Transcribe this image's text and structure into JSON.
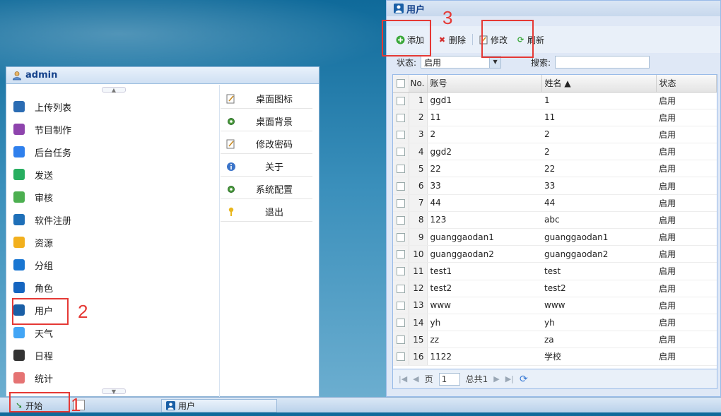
{
  "start_menu": {
    "username": "admin",
    "left_items": [
      {
        "label": "上传列表",
        "icon": "upload-icon",
        "color": "#2b6cb3"
      },
      {
        "label": "节目制作",
        "icon": "program-icon",
        "color": "#8e44ad"
      },
      {
        "label": "后台任务",
        "icon": "tasks-icon",
        "color": "#2f80ed"
      },
      {
        "label": "发送",
        "icon": "send-icon",
        "color": "#27ae60"
      },
      {
        "label": "审核",
        "icon": "check-icon",
        "color": "#4caf50"
      },
      {
        "label": "软件注册",
        "icon": "register-icon",
        "color": "#1e6fb8"
      },
      {
        "label": "资源",
        "icon": "resource-icon",
        "color": "#f2b01e"
      },
      {
        "label": "分组",
        "icon": "group-icon",
        "color": "#1976d2"
      },
      {
        "label": "角色",
        "icon": "role-icon",
        "color": "#1565c0"
      },
      {
        "label": "用户",
        "icon": "user-icon",
        "color": "#1a5fa6"
      },
      {
        "label": "天气",
        "icon": "weather-icon",
        "color": "#42a5f5"
      },
      {
        "label": "日程",
        "icon": "schedule-icon",
        "color": "#333333"
      },
      {
        "label": "统计",
        "icon": "stats-icon",
        "color": "#e57373"
      }
    ],
    "right_items": [
      {
        "label": "桌面图标",
        "icon": "edit-icon"
      },
      {
        "label": "桌面背景",
        "icon": "gear-icon"
      },
      {
        "label": "修改密码",
        "icon": "edit-icon"
      },
      {
        "label": "关于",
        "icon": "info-icon"
      },
      {
        "label": "系统配置",
        "icon": "gear-icon"
      },
      {
        "label": "退出",
        "icon": "key-icon"
      }
    ]
  },
  "taskbar": {
    "start_label": "开始",
    "task_label": "用户"
  },
  "window": {
    "title": "用户",
    "toolbar": {
      "add": "添加",
      "delete": "删除",
      "edit": "修改",
      "refresh": "刷新"
    },
    "filter": {
      "status_label": "状态:",
      "status_value": "启用",
      "search_label": "搜索:"
    },
    "grid": {
      "headers": {
        "no": "No.",
        "account": "账号",
        "name": "姓名 ▲",
        "status": "状态"
      },
      "rows": [
        {
          "no": "1",
          "account": "ggd1",
          "name": "1",
          "status": "启用"
        },
        {
          "no": "2",
          "account": "11",
          "name": "11",
          "status": "启用"
        },
        {
          "no": "3",
          "account": "2",
          "name": "2",
          "status": "启用"
        },
        {
          "no": "4",
          "account": "ggd2",
          "name": "2",
          "status": "启用"
        },
        {
          "no": "5",
          "account": "22",
          "name": "22",
          "status": "启用"
        },
        {
          "no": "6",
          "account": "33",
          "name": "33",
          "status": "启用"
        },
        {
          "no": "7",
          "account": "44",
          "name": "44",
          "status": "启用"
        },
        {
          "no": "8",
          "account": "123",
          "name": "abc",
          "status": "启用"
        },
        {
          "no": "9",
          "account": "guanggaodan1",
          "name": "guanggaodan1",
          "status": "启用"
        },
        {
          "no": "10",
          "account": "guanggaodan2",
          "name": "guanggaodan2",
          "status": "启用"
        },
        {
          "no": "11",
          "account": "test1",
          "name": "test",
          "status": "启用"
        },
        {
          "no": "12",
          "account": "test2",
          "name": "test2",
          "status": "启用"
        },
        {
          "no": "13",
          "account": "www",
          "name": "www",
          "status": "启用"
        },
        {
          "no": "14",
          "account": "yh",
          "name": "yh",
          "status": "启用"
        },
        {
          "no": "15",
          "account": "zz",
          "name": "za",
          "status": "启用"
        },
        {
          "no": "16",
          "account": "1122",
          "name": "学校",
          "status": "启用"
        }
      ]
    },
    "pager": {
      "page_label": "页",
      "page_value": "1",
      "total_label": "总共1"
    }
  },
  "annotations": {
    "one": "1",
    "two": "2",
    "three": "3"
  }
}
